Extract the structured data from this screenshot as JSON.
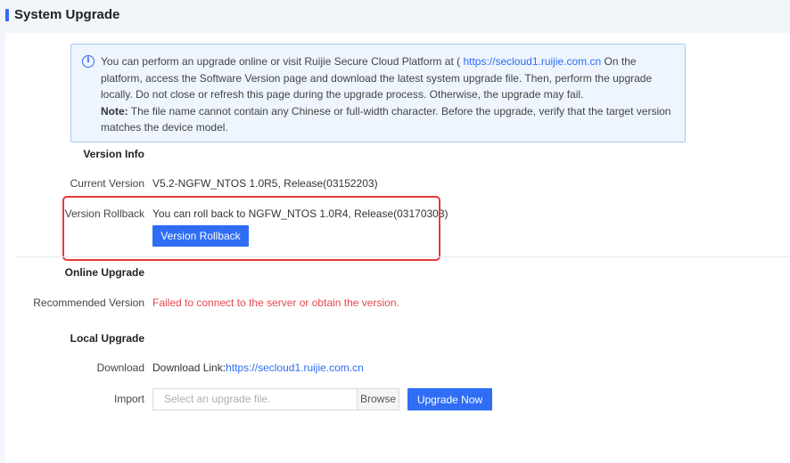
{
  "header": {
    "title": "System Upgrade"
  },
  "notice": {
    "text_before_link": "You can perform an upgrade online or visit Ruijie Secure Cloud Platform at ( ",
    "link": "https://secloud1.ruijie.com.cn",
    "text_after_link": " On the platform, access the Software Version page and download the latest system upgrade file. Then, perform the upgrade locally. Do not close or refresh this page during the upgrade process. Otherwise, the upgrade may fail.",
    "note_label": "Note:",
    "note_text": " The file name cannot contain any Chinese or full-width character. Before the upgrade, verify that the target version matches the device model."
  },
  "version_info": {
    "section_title": "Version Info",
    "current_label": "Current Version",
    "current_value": "V5.2-NGFW_NTOS 1.0R5, Release(03152203)",
    "rollback_label": "Version Rollback",
    "rollback_value": "You can roll back to NGFW_NTOS 1.0R4, Release(03170303)",
    "rollback_button": "Version Rollback"
  },
  "online_upgrade": {
    "section_title": "Online Upgrade",
    "recommended_label": "Recommended Version",
    "recommended_value": "Failed to connect to the server or obtain the version."
  },
  "local_upgrade": {
    "section_title": "Local Upgrade",
    "download_label": "Download",
    "download_prefix": "Download Link:",
    "download_link": "https://secloud1.ruijie.com.cn",
    "import_label": "Import",
    "file_placeholder": "Select an upgrade file.",
    "browse_button": "Browse",
    "upgrade_button": "Upgrade Now"
  },
  "colors": {
    "accent": "#2f6df5",
    "error": "#e5484d",
    "highlight_border": "#e5393b",
    "notice_bg": "#eef5ff"
  }
}
